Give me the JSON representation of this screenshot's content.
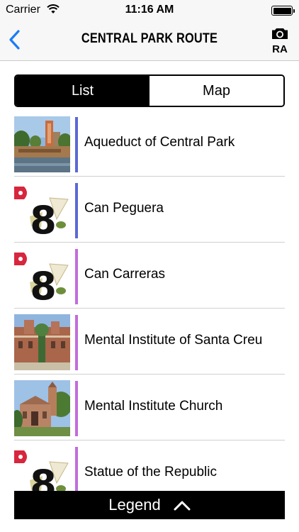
{
  "status_bar": {
    "carrier": "Carrier",
    "time": "11:16 AM",
    "battery_level": 1.0
  },
  "nav": {
    "title": "CENTRAL PARK ROUTE",
    "back_icon": "chevron-left-icon",
    "ar_label": "RA",
    "ar_icon": "camera-icon",
    "accent_color": "#1a7cf5"
  },
  "segments": {
    "list_label": "List",
    "map_label": "Map",
    "selected": "List"
  },
  "items": [
    {
      "label": "Aqueduct of Central Park",
      "thumb": "photo-park-aqueduct",
      "color": "#5a69d6"
    },
    {
      "label": "Can Peguera",
      "thumb": "logo-8",
      "color": "#5a69d6"
    },
    {
      "label": "Can Carreras",
      "thumb": "logo-8",
      "color": "#c26cdc"
    },
    {
      "label": "Mental Institute of Santa Creu",
      "thumb": "photo-institute",
      "color": "#c26cdc"
    },
    {
      "label": "Mental Institute Church",
      "thumb": "photo-church",
      "color": "#c26cdc"
    },
    {
      "label": "Statue of the Republic",
      "thumb": "logo-8",
      "color": "#c26cdc"
    }
  ],
  "legend": {
    "label": "Legend",
    "icon": "chevron-up-icon"
  }
}
